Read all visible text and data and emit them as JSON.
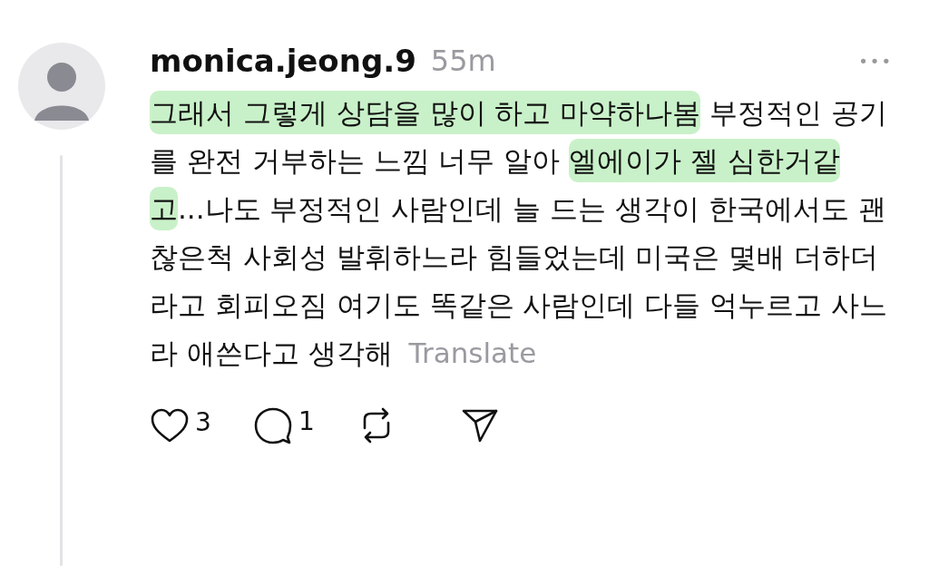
{
  "post": {
    "username": "monica.jeong.9",
    "time": "55m",
    "more": "•••",
    "body": [
      {
        "text": "그래서 그렇게 상담을 많이 하고 마약하나봄",
        "highlighted": true
      },
      {
        "text": " 부정적인 공기를 완전 거부하는 느낌 너무 알아 ",
        "highlighted": false
      },
      {
        "text": "엘에이가 젤 심한거같고",
        "highlighted": true
      },
      {
        "text": "...나도 부정적인 사람인데 늘 드는 생각이 한국에서도 괜찮은척 사회성 발휘하느라 힘들었는데 미국은 몇배 더하더라고 회피오짐 여기도 똑같은 사람인데 다들 억누르고 사느라 애쓴다고 생각해",
        "highlighted": false
      }
    ],
    "translate": "Translate",
    "actions": [
      {
        "kind": "like",
        "count": "3"
      },
      {
        "kind": "reply",
        "count": "1"
      },
      {
        "kind": "repost"
      },
      {
        "kind": "share"
      }
    ]
  }
}
